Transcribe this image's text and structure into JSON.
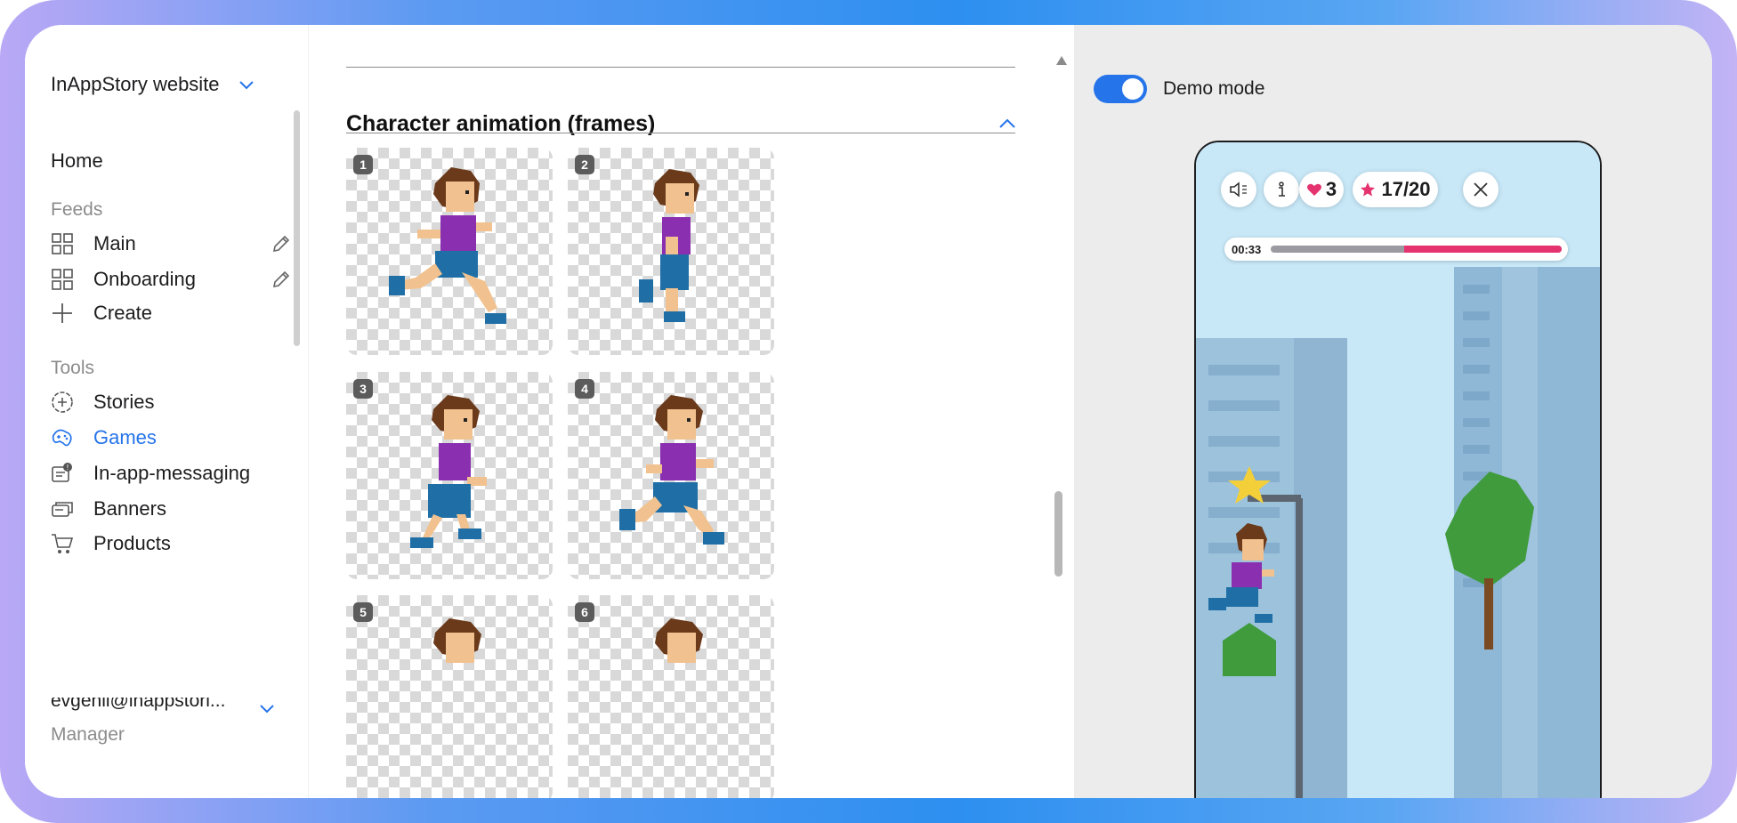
{
  "sidebar": {
    "site_selector": "InAppStory website",
    "home": "Home",
    "feeds_title": "Feeds",
    "feeds": [
      {
        "label": "Main",
        "icon": "grid-icon"
      },
      {
        "label": "Onboarding",
        "icon": "grid-icon"
      }
    ],
    "create_label": "Create",
    "tools_title": "Tools",
    "tools": [
      {
        "label": "Stories",
        "icon": "stories-icon"
      },
      {
        "label": "Games",
        "icon": "gamepad-icon",
        "active": true
      },
      {
        "label": "In-app-messaging",
        "icon": "message-icon"
      },
      {
        "label": "Banners",
        "icon": "banners-icon"
      },
      {
        "label": "Products",
        "icon": "cart-icon"
      }
    ],
    "account_email": "evgenii@inappstori...",
    "account_role": "Manager"
  },
  "content": {
    "section_title": "Character animation (frames)",
    "frames": [
      {
        "number": "1"
      },
      {
        "number": "2"
      },
      {
        "number": "3"
      },
      {
        "number": "4"
      },
      {
        "number": "5"
      },
      {
        "number": "6"
      }
    ]
  },
  "preview": {
    "demo_mode_label": "Demo mode",
    "demo_mode_on": true,
    "game": {
      "lives": "3",
      "stars": "17/20",
      "timer": "00:33",
      "time_remaining_fraction": 0.54
    }
  },
  "colors": {
    "accent": "#2574ea",
    "progress": "#e5336f",
    "star": "#e5336f"
  }
}
